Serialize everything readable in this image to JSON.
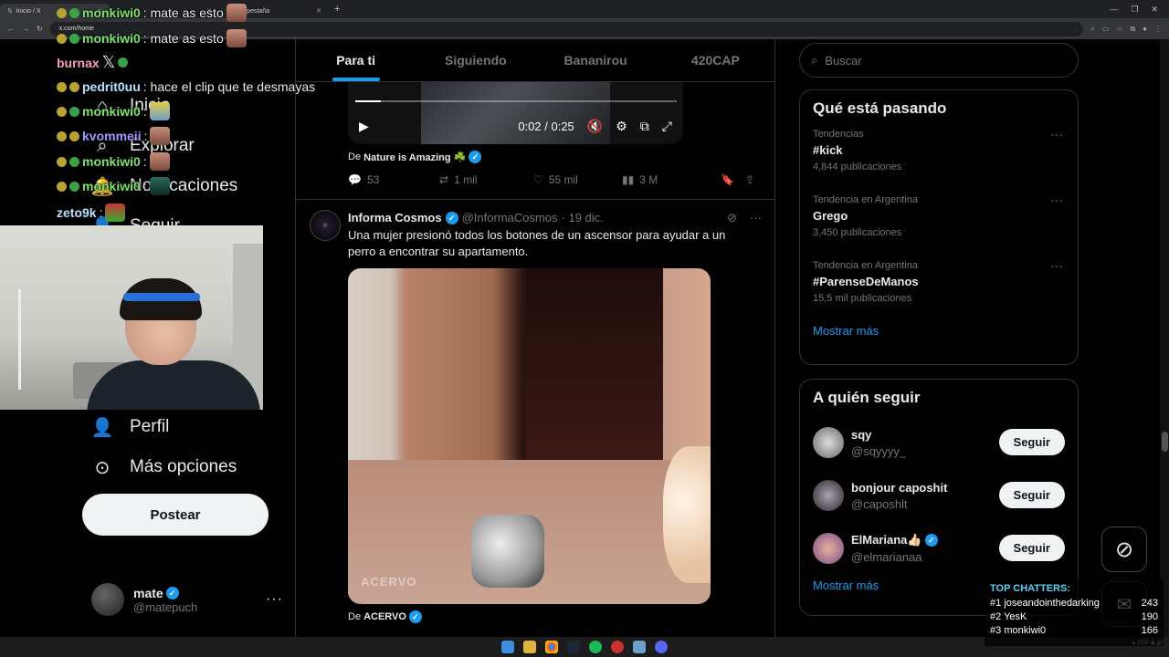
{
  "browser": {
    "tabs": [
      "Inicio / X",
      "",
      "Nueva pestaña"
    ],
    "url": "x.com/home"
  },
  "sidebar": {
    "items": [
      {
        "label": "Inicio",
        "icon": "home-icon"
      },
      {
        "label": "Explorar",
        "icon": "search-icon"
      },
      {
        "label": "Notificaciones",
        "icon": "bell-icon"
      },
      {
        "label": "Seguir",
        "icon": "person-icon"
      },
      {
        "label": "Perfil",
        "icon": "person-icon"
      },
      {
        "label": "Más opciones",
        "icon": "more-circle-icon"
      }
    ],
    "post_button": "Postear",
    "account": {
      "name": "mate",
      "handle": "@matepuch"
    }
  },
  "feed": {
    "tabs": [
      "Para ti",
      "Siguiendo",
      "Bananirou",
      "420CAP"
    ],
    "active_tab": 0,
    "video1": {
      "time": "0:02 / 0:25",
      "progress": 0.08
    },
    "tweet1": {
      "from_prefix": "De",
      "from_source": "Nature is Amazing ☘️",
      "replies": "53",
      "reposts": "1 mil",
      "likes": "55 mil",
      "views": "3 M"
    },
    "tweet2": {
      "name": "Informa Cosmos",
      "handle": "@InformaCosmos",
      "date": "· 19 dic.",
      "text": "Una mujer presionó todos los botones de un ascensor para ayudar a un perro a encontrar su apartamento.",
      "watermark": "ACERVO",
      "from_prefix": "De",
      "from_source": "ACERVO"
    }
  },
  "right": {
    "search_placeholder": "Buscar",
    "trends_title": "Qué está pasando",
    "trends": [
      {
        "context": "Tendencias",
        "name": "#kick",
        "count": "4,844 publicaciones"
      },
      {
        "context": "Tendencia en Argentina",
        "name": "Grego",
        "count": "3,450 publicaciones"
      },
      {
        "context": "Tendencia en Argentina",
        "name": "#ParenseDeManos",
        "count": "15,5 mil publicaciones"
      }
    ],
    "show_more": "Mostrar más",
    "who_title": "A quién seguir",
    "who": [
      {
        "name": "sqy",
        "handle": "@sqyyyy_",
        "button": "Seguir"
      },
      {
        "name": "bonjour caposhit",
        "handle": "@caposhlt",
        "button": "Seguir"
      },
      {
        "name": "ElMariana👍🏻",
        "handle": "@elmarianaa",
        "button": "Seguir"
      }
    ]
  },
  "stream": {
    "chat": [
      {
        "user": "monkiwi0",
        "msg": ": mate as esto"
      },
      {
        "user": "monkiwi0",
        "msg": ": mate as esto"
      },
      {
        "user": "burnax",
        "msg": ""
      },
      {
        "user": "pedrit0uu",
        "msg": ": hace el clip que te desmayas"
      },
      {
        "user": "monkiwi0",
        "msg": ":"
      },
      {
        "user": "kvommeii",
        "msg": ":"
      },
      {
        "user": "monkiwi0",
        "msg": ":"
      },
      {
        "user": "monkiwi0",
        "msg": ":"
      },
      {
        "user": "zeto9k",
        "msg": ":"
      }
    ],
    "top_chatters_title": "TOP CHATTERS:",
    "top_chatters": [
      {
        "rank": "#1",
        "name": "joseandointhedarking",
        "count": "243"
      },
      {
        "rank": "#2",
        "name": "YesK",
        "count": "190"
      },
      {
        "rank": "#3",
        "name": "monkiwi0",
        "count": "166"
      }
    ]
  },
  "colors": {
    "accent": "#1d9bf0",
    "background": "#000000",
    "border": "#2f3336",
    "muted": "#71767b"
  }
}
